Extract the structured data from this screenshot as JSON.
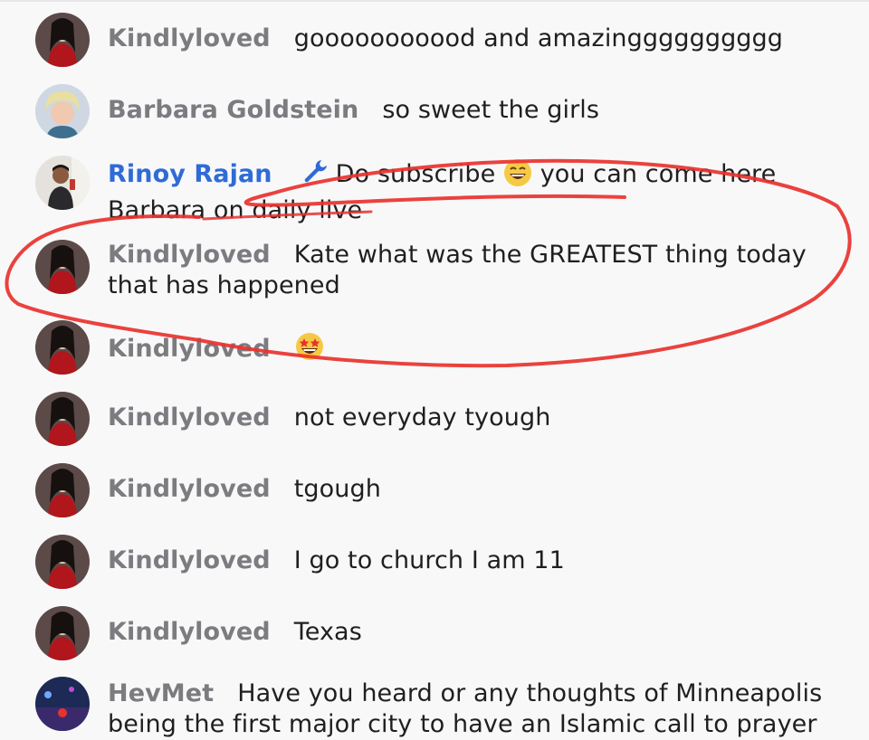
{
  "chat": {
    "messages": [
      {
        "author": "Kindlyloved",
        "text": "gooooooooood and amazingggggggggg"
      },
      {
        "author": "Barbara Goldstein",
        "text": "so sweet the girls"
      },
      {
        "author": "Rinoy Rajan",
        "text_before": "Do subscribe",
        "text_after": "you can come here Barbara on daily live",
        "emoji": "grinning-face-with-smiling-eyes",
        "badge": "wrench-icon"
      },
      {
        "author": "Kindlyloved",
        "text": "Kate what was the GREATEST thing today that has happened"
      },
      {
        "author": "Kindlyloved",
        "text": "",
        "emoji": "star-struck-face"
      },
      {
        "author": "Kindlyloved",
        "text": "not everyday tyough"
      },
      {
        "author": "Kindlyloved",
        "text": "tgough"
      },
      {
        "author": "Kindlyloved",
        "text": "I go to church I am 11"
      },
      {
        "author": "Kindlyloved",
        "text": "Texas"
      },
      {
        "author": "HevMet",
        "text": "Have you heard or any thoughts of Minneapolis being the first major city to have an Islamic call to prayer"
      }
    ]
  },
  "colors": {
    "background": "#f8f8f9",
    "author_name": "#7b7b80",
    "moderator_name": "#2f6bd6",
    "message_text": "#1f1f21",
    "annotation_stroke": "#e8322e"
  }
}
